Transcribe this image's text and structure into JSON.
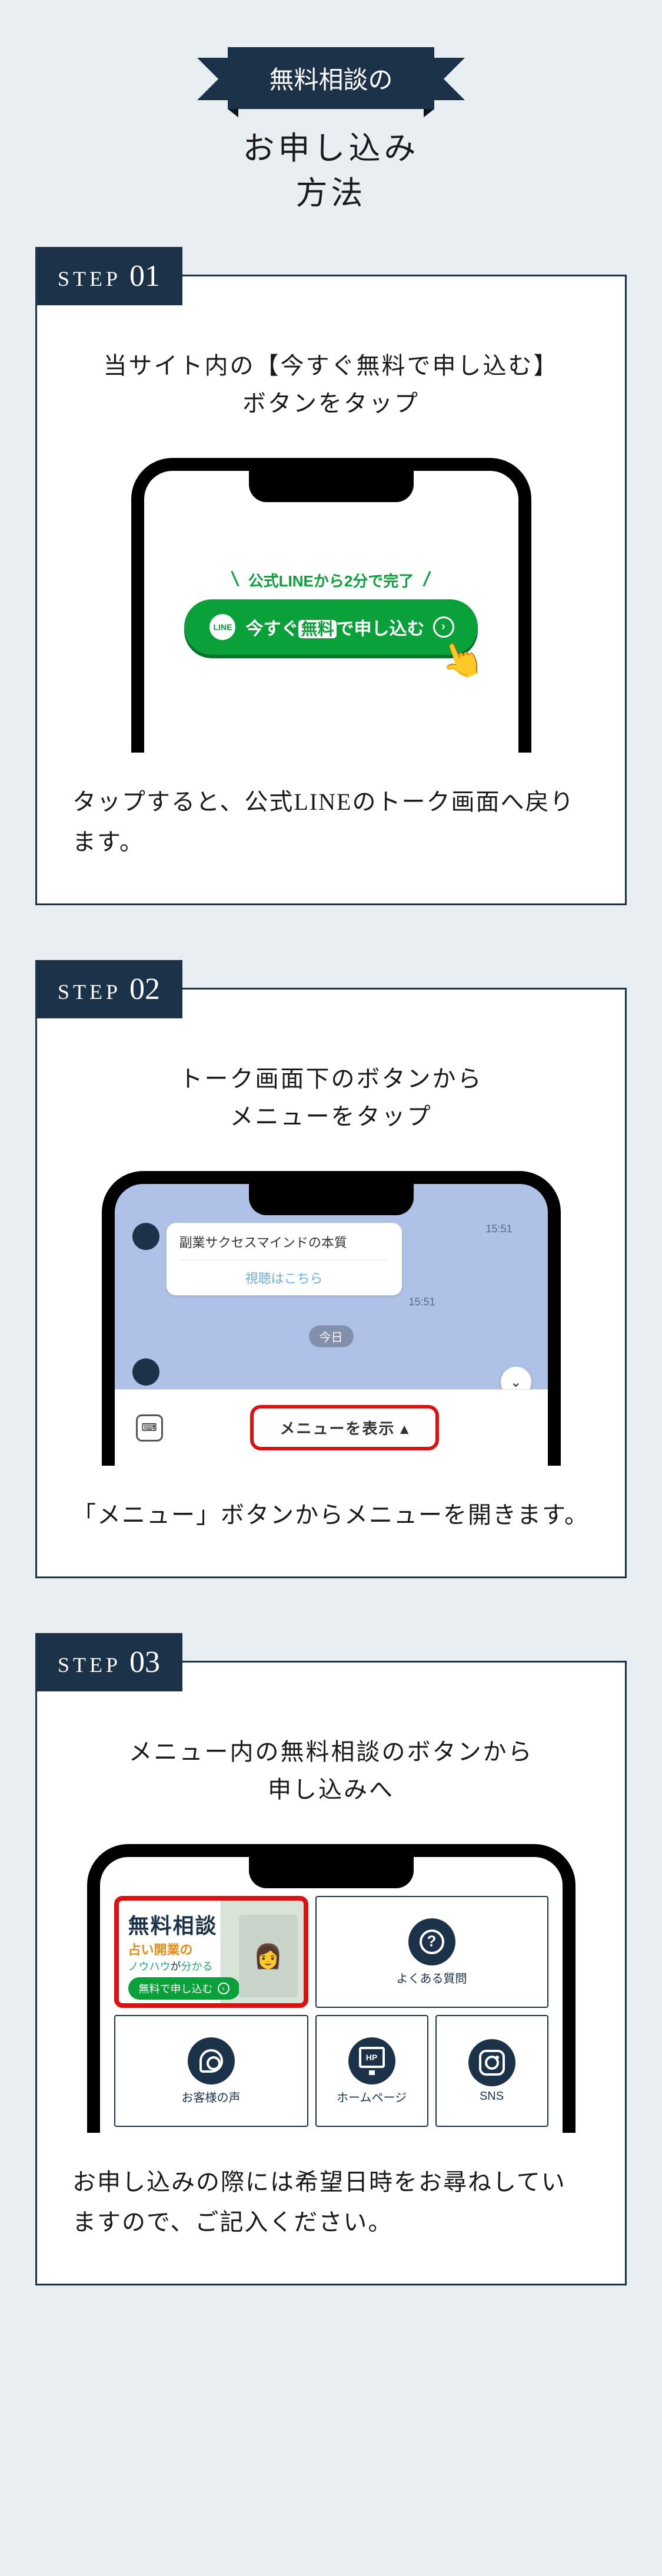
{
  "header": {
    "ribbon": "無料相談の",
    "subtitle_l1": "お申し込み",
    "subtitle_l2": "方法"
  },
  "steps": [
    {
      "label_word": "STEP",
      "label_num": "01",
      "title_l1": "当サイト内の【今すぐ無料で申し込む】",
      "title_l2": "ボタンをタップ",
      "note": "タップすると、公式LINEのトーク画面へ戻ります。",
      "mock": {
        "caption": "公式LINEから2分で完了",
        "btn_prefix": "今すぐ",
        "btn_free": "無料",
        "btn_suffix": "で申し込む",
        "line_badge": "LINE"
      }
    },
    {
      "label_word": "STEP",
      "label_num": "02",
      "title_l1": "トーク画面下のボタンから",
      "title_l2": "メニューをタップ",
      "note": "「メニュー」ボタンからメニューを開きます。",
      "mock": {
        "bubble_title": "副業サクセスマインドの本質",
        "bubble_link": "視聴はこちら",
        "timestamp": "15:51",
        "date": "今日",
        "menu_btn": "メニューを表示 ▴"
      }
    },
    {
      "label_word": "STEP",
      "label_num": "03",
      "title_l1": "メニュー内の無料相談のボタンから",
      "title_l2": "申し込みへ",
      "note": "お申し込みの際には希望日時をお尋ねしていますので、ご記入ください。",
      "mock": {
        "promo_title": "無料相談",
        "promo_l1": "占い開業の",
        "promo_l2a": "ノウハウ",
        "promo_l2b": "が",
        "promo_l2c": "分かる",
        "promo_btn": "無料で申し込む",
        "faq": "よくある質問",
        "voice": "お客様の声",
        "hp": "ホームページ",
        "sns": "SNS"
      }
    }
  ]
}
